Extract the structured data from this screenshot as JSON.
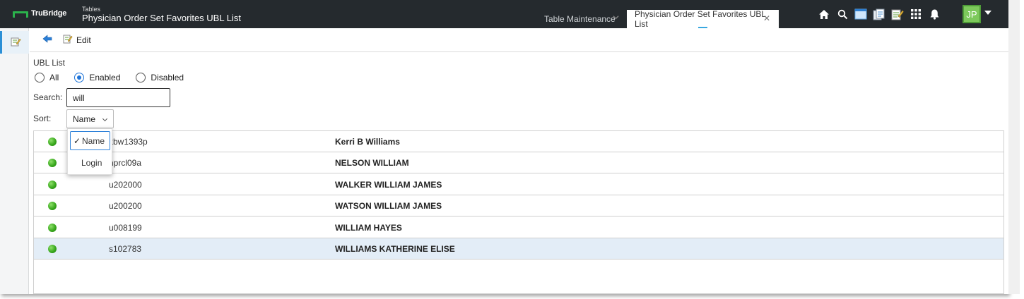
{
  "app": {
    "logo_text": "TruBridge",
    "breadcrumb": "Tables",
    "title": "Physician Order Set Favorites UBL List"
  },
  "tabs": [
    {
      "label": "Table Maintenance",
      "active": false
    },
    {
      "label": "Physician Order Set Favorites UBL List",
      "active": true
    }
  ],
  "top_icons": [
    "home-icon",
    "search-icon",
    "window-icon",
    "documents-icon",
    "notes-icon",
    "apps-grid-icon",
    "bell-icon"
  ],
  "user": {
    "initials": "JP"
  },
  "toolbar": {
    "edit_label": "Edit"
  },
  "filter": {
    "section_label": "UBL List",
    "options": [
      {
        "label": "All",
        "selected": false
      },
      {
        "label": "Enabled",
        "selected": true
      },
      {
        "label": "Disabled",
        "selected": false
      }
    ]
  },
  "search": {
    "label": "Search:",
    "value": "will"
  },
  "sort": {
    "label": "Sort:",
    "value": "Name",
    "options": [
      {
        "label": "Name",
        "selected": true
      },
      {
        "label": "Login",
        "selected": false
      }
    ]
  },
  "rows": [
    {
      "status": "enabled",
      "login": "kbw1393p",
      "name": "Kerri B Williams",
      "selected": false
    },
    {
      "status": "enabled",
      "login": "nprcl09a",
      "name": "NELSON WILLIAM",
      "selected": false
    },
    {
      "status": "enabled",
      "login": "u202000",
      "name": "WALKER WILLIAM JAMES",
      "selected": false
    },
    {
      "status": "enabled",
      "login": "u200200",
      "name": "WATSON WILLIAM JAMES",
      "selected": false
    },
    {
      "status": "enabled",
      "login": "u008199",
      "name": "WILLIAM HAYES",
      "selected": false
    },
    {
      "status": "enabled",
      "login": "s102783",
      "name": "WILLIAMS KATHERINE ELISE",
      "selected": true
    }
  ],
  "colors": {
    "topbar": "#252a2e",
    "accent": "#1e73d8",
    "status_green": "#3aa91e",
    "selected_row": "#e3edf7"
  }
}
